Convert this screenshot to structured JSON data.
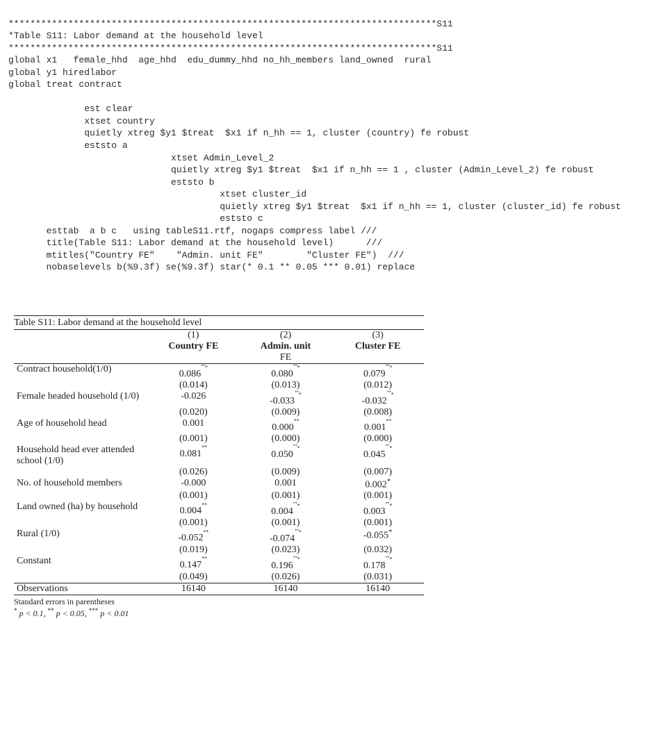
{
  "code": {
    "l1": "*******************************************************************************S11",
    "l2": "*Table S11: Labor demand at the household level",
    "l3": "*******************************************************************************S11",
    "l4": "global x1   female_hhd  age_hhd  edu_dummy_hhd no_hh_members land_owned  rural",
    "l5": "global y1 hiredlabor",
    "l6": "global treat contract",
    "l7": "",
    "l8": "              est clear",
    "l9": "              xtset country",
    "l10": "              quietly xtreg $y1 $treat  $x1 if n_hh == 1, cluster (country) fe robust",
    "l11": "              eststo a",
    "l12": "                              xtset Admin_Level_2",
    "l13": "                              quietly xtreg $y1 $treat  $x1 if n_hh == 1 , cluster (Admin_Level_2) fe robust",
    "l14": "                              eststo b",
    "l15": "                                       xtset cluster_id",
    "l16": "                                       quietly xtreg $y1 $treat  $x1 if n_hh == 1, cluster (cluster_id) fe robust",
    "l17": "                                       eststo c",
    "l18": "       esttab  a b c   using tableS11.rtf, nogaps compress label ///",
    "l19": "       title(Table S11: Labor demand at the household level)      ///",
    "l20": "       mtitles(\"Country FE\"    \"Admin. unit FE\"        \"Cluster FE\")  ///",
    "l21": "       nobaselevels b(%9.3f) se(%9.3f) star(* 0.1 ** 0.05 *** 0.01) replace"
  },
  "table": {
    "title": "Table S11: Labor demand at the household level",
    "cols": {
      "n1": "(1)",
      "n2": "(2)",
      "n3": "(3)",
      "h1": "Country FE",
      "h2a": "Admin. unit",
      "h2b": "FE",
      "h3": "Cluster FE"
    },
    "rows": {
      "contract": {
        "label": "Contract household(1/0)",
        "b1": "0.086***",
        "b2": "0.080***",
        "b3": "0.079***",
        "se1": "(0.014)",
        "se2": "(0.013)",
        "se3": "(0.012)"
      },
      "female": {
        "label": "Female headed household (1/0)",
        "b1": "-0.026",
        "b2": "-0.033***",
        "b3": "-0.032***",
        "se1": "(0.020)",
        "se2": "(0.009)",
        "se3": "(0.008)"
      },
      "age": {
        "label": "Age of household head",
        "b1": "0.001",
        "b2": "0.000**",
        "b3": "0.001**",
        "se1": "(0.001)",
        "se2": "(0.000)",
        "se3": "(0.000)"
      },
      "edu": {
        "label": "Household head ever attended school (1/0)",
        "b1": "0.081**",
        "b2": "0.050***",
        "b3": "0.045***",
        "se1": "(0.026)",
        "se2": "(0.009)",
        "se3": "(0.007)"
      },
      "members": {
        "label": "No. of household members",
        "b1": "-0.000",
        "b2": "0.001",
        "b3": "0.002*",
        "se1": "(0.001)",
        "se2": "(0.001)",
        "se3": "(0.001)"
      },
      "land": {
        "label": "Land owned (ha) by household",
        "b1": "0.004**",
        "b2": "0.004***",
        "b3": "0.003***",
        "se1": "(0.001)",
        "se2": "(0.001)",
        "se3": "(0.001)"
      },
      "rural": {
        "label": "Rural (1/0)",
        "b1": "-0.052**",
        "b2": "-0.074***",
        "b3": "-0.055*",
        "se1": "(0.019)",
        "se2": "(0.023)",
        "se3": "(0.032)"
      },
      "constant": {
        "label": "Constant",
        "b1": "0.147**",
        "b2": "0.196***",
        "b3": "0.178***",
        "se1": "(0.049)",
        "se2": "(0.026)",
        "se3": "(0.031)"
      }
    },
    "obs": {
      "label": "Observations",
      "v1": "16140",
      "v2": "16140",
      "v3": "16140"
    },
    "footnote": {
      "se": "Standard errors in parentheses",
      "sig_prefix": "*",
      "sig_p1": "p < 0.1, ",
      "sig_star2": "**",
      "sig_p2": "p < 0.05, ",
      "sig_star3": "***",
      "sig_p3": " p < 0.01"
    }
  }
}
